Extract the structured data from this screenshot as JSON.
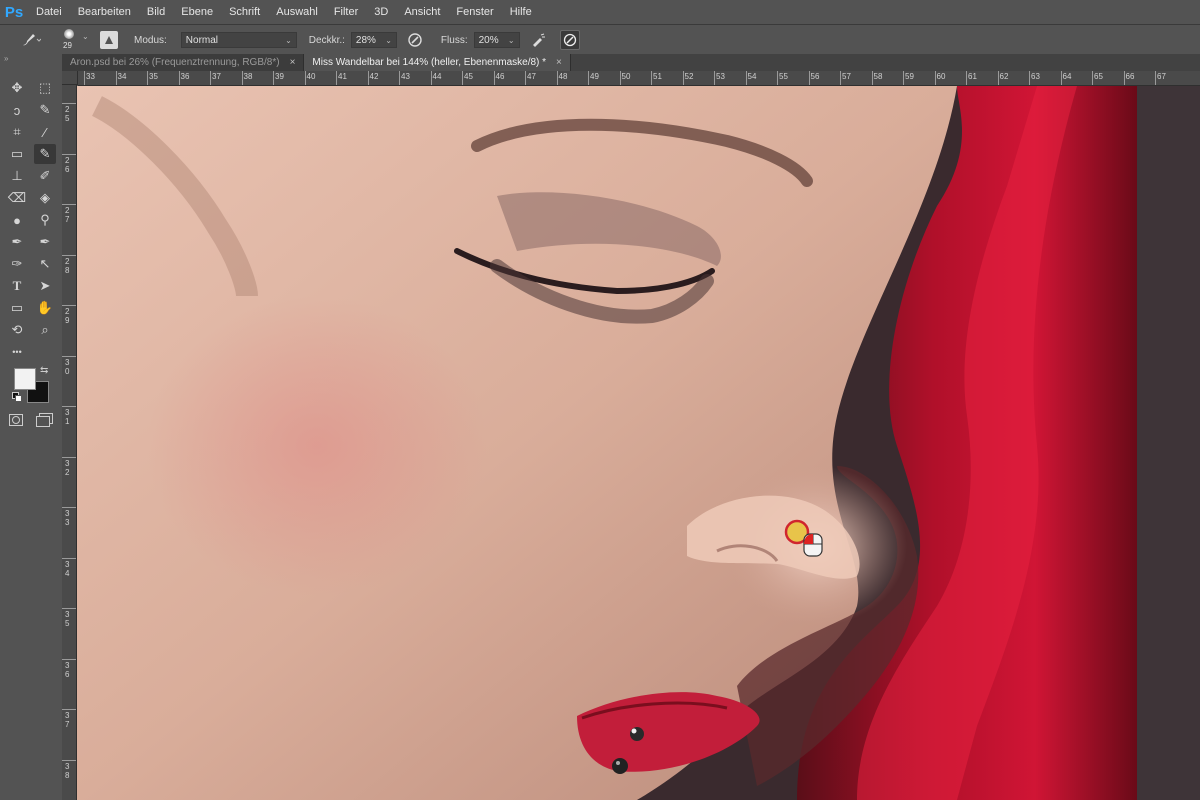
{
  "app": {
    "logo": "Ps"
  },
  "menu": [
    "Datei",
    "Bearbeiten",
    "Bild",
    "Ebene",
    "Schrift",
    "Auswahl",
    "Filter",
    "3D",
    "Ansicht",
    "Fenster",
    "Hilfe"
  ],
  "options": {
    "brush_size": "29",
    "mode_label": "Modus:",
    "mode_value": "Normal",
    "opacity_label": "Deckkr.:",
    "opacity_value": "28%",
    "flow_label": "Fluss:",
    "flow_value": "20%"
  },
  "tabs": [
    {
      "label": "Aron.psd bei 26% (Frequenztrennung, RGB/8*)",
      "close": "×",
      "active": false
    },
    {
      "label": "Miss Wandelbar bei 144% (heller, Ebenenmaske/8) *",
      "close": "×",
      "active": true
    }
  ],
  "ruler": {
    "top_labels": [
      "33",
      "34",
      "35",
      "36",
      "37",
      "38",
      "39",
      "40",
      "41",
      "42",
      "43",
      "44",
      "45",
      "46",
      "47",
      "48",
      "49",
      "50",
      "51",
      "52",
      "53",
      "54",
      "55",
      "56",
      "57",
      "58",
      "59",
      "60",
      "61",
      "62",
      "63",
      "64",
      "65",
      "66",
      "67"
    ],
    "left_labels": [
      "2\n5",
      "2\n6",
      "2\n7",
      "2\n8",
      "2\n9",
      "3\n0",
      "3\n1",
      "3\n2",
      "3\n3",
      "3\n4",
      "3\n5",
      "3\n6",
      "3\n7",
      "3\n8"
    ]
  },
  "colors": {
    "foreground": "#f2f2f2",
    "background": "#111111",
    "ps_blue": "#31a8ff"
  },
  "tools": [
    "move-icon",
    "marquee-icon",
    "lasso-icon",
    "quick-select-icon",
    "crop-icon",
    "eyedropper-icon",
    "healing-brush-icon",
    "brush-icon",
    "clone-stamp-icon",
    "history-brush-icon",
    "eraser-icon",
    "paint-bucket-icon",
    "blur-icon",
    "dodge-icon",
    "pen-icon",
    "freeform-pen-icon",
    "pen-alt-icon",
    "path-select-icon",
    "type-icon",
    "direct-select-icon",
    "rectangle-icon",
    "hand-icon",
    "rotate-view-icon",
    "zoom-icon",
    "more-tools-icon"
  ]
}
